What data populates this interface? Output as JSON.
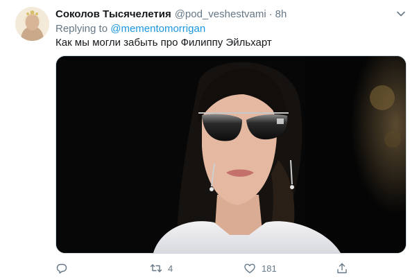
{
  "tweet": {
    "display_name": "Соколов Тысячелетия",
    "handle": "@pod_veshestvami",
    "separator": "·",
    "time": "8h",
    "replying_prefix": "Replying to",
    "replying_to": "@mementomorrigan",
    "text": "Как мы могли забыть про Филиппу Эйльхарт"
  },
  "actions": {
    "reply_icon": "comment-icon",
    "retweet_icon": "retweet-icon",
    "retweet_count": "4",
    "like_icon": "heart-icon",
    "like_count": "181",
    "share_icon": "share-icon"
  },
  "colors": {
    "accent": "#1b95e0",
    "secondary_text": "#657786",
    "primary_text": "#14171a"
  }
}
